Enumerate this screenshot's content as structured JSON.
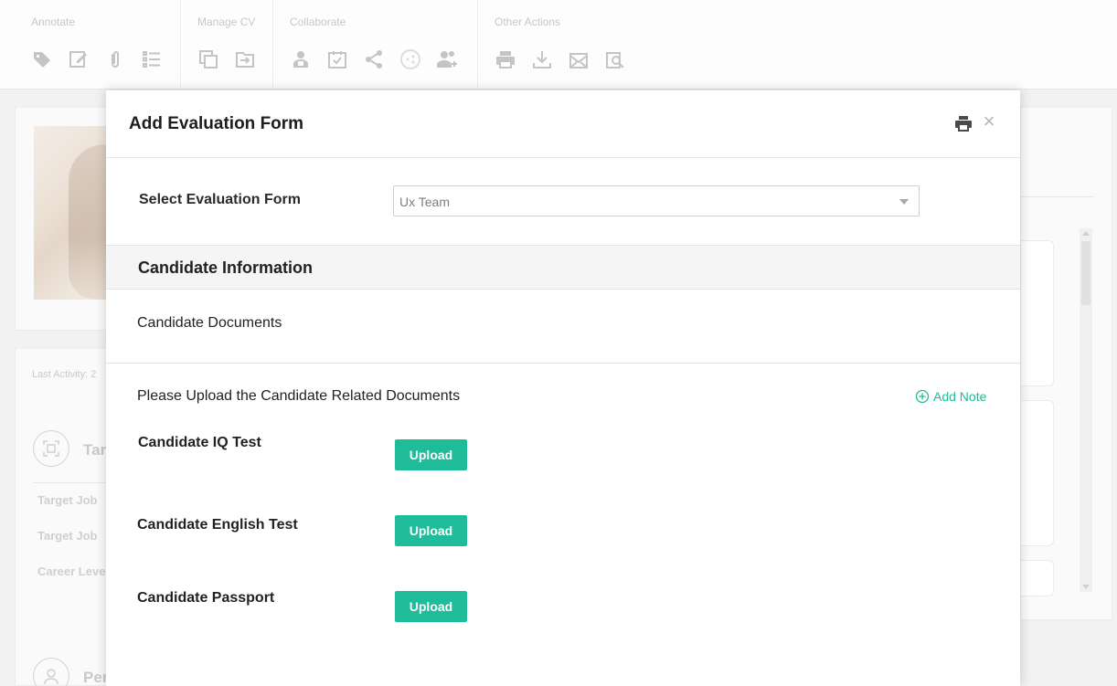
{
  "toolbar": {
    "groups": [
      {
        "label": "Annotate",
        "icons": [
          "tag-icon",
          "edit-icon",
          "paperclip-icon",
          "checklist-icon"
        ]
      },
      {
        "label": "Manage CV",
        "icons": [
          "copy-icon",
          "move-to-folder-icon"
        ]
      },
      {
        "label": "Collaborate",
        "icons": [
          "assign-user-icon",
          "calendar-check-icon",
          "share-icon",
          "network-icon",
          "add-users-icon"
        ]
      },
      {
        "label": "Other Actions",
        "icons": [
          "print-icon",
          "download-icon",
          "email-icon",
          "preview-icon"
        ]
      }
    ]
  },
  "background": {
    "last_activity": "Last Activity: 2",
    "section_one_title": "Tar",
    "section_two_title": "Per",
    "rows": [
      "Target Job",
      "Target Job",
      "Career Leve"
    ]
  },
  "modal": {
    "title": "Add Evaluation Form",
    "print_icon": "print-icon",
    "close_icon": "×",
    "select_label": "Select Evaluation Form",
    "select_value": "Ux Team",
    "section_title": "Candidate Information",
    "documents_label": "Candidate Documents",
    "upload_intro": "Please Upload the Candidate Related Documents",
    "add_note_label": "Add Note",
    "documents": [
      {
        "label": "Candidate IQ Test",
        "button": "Upload"
      },
      {
        "label": "Candidate English Test",
        "button": "Upload"
      },
      {
        "label": "Candidate Passport",
        "button": "Upload"
      }
    ]
  },
  "colors": {
    "accent": "#1ebc98",
    "overlay": "#f2f2f2",
    "faded_icon": "#c4c4c4"
  }
}
